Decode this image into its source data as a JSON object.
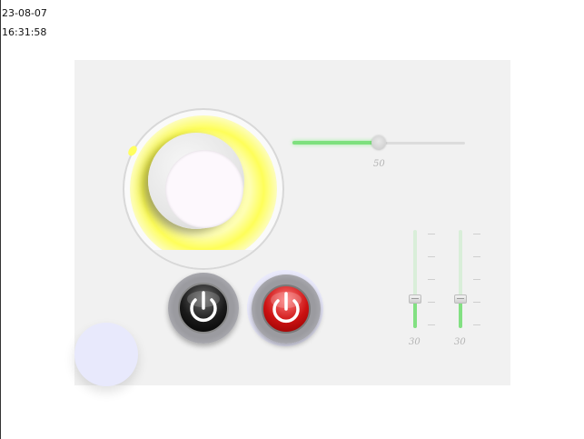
{
  "header": {
    "date": "23-08-07",
    "time": "16:31:58"
  },
  "dial": {
    "glow_color": "#ffff40",
    "icon": "knob"
  },
  "h_slider": {
    "value_label": "50",
    "fraction": 0.5,
    "accent": "#7ee07e"
  },
  "v_sliders": [
    {
      "value_label": "30",
      "fraction": 0.3
    },
    {
      "value_label": "30",
      "fraction": 0.3
    }
  ],
  "power_buttons": [
    {
      "icon": "power-icon",
      "color": "#000000"
    },
    {
      "icon": "power-icon",
      "color": "#cc1212"
    }
  ],
  "fab": {
    "color": "#e8e9fc"
  }
}
